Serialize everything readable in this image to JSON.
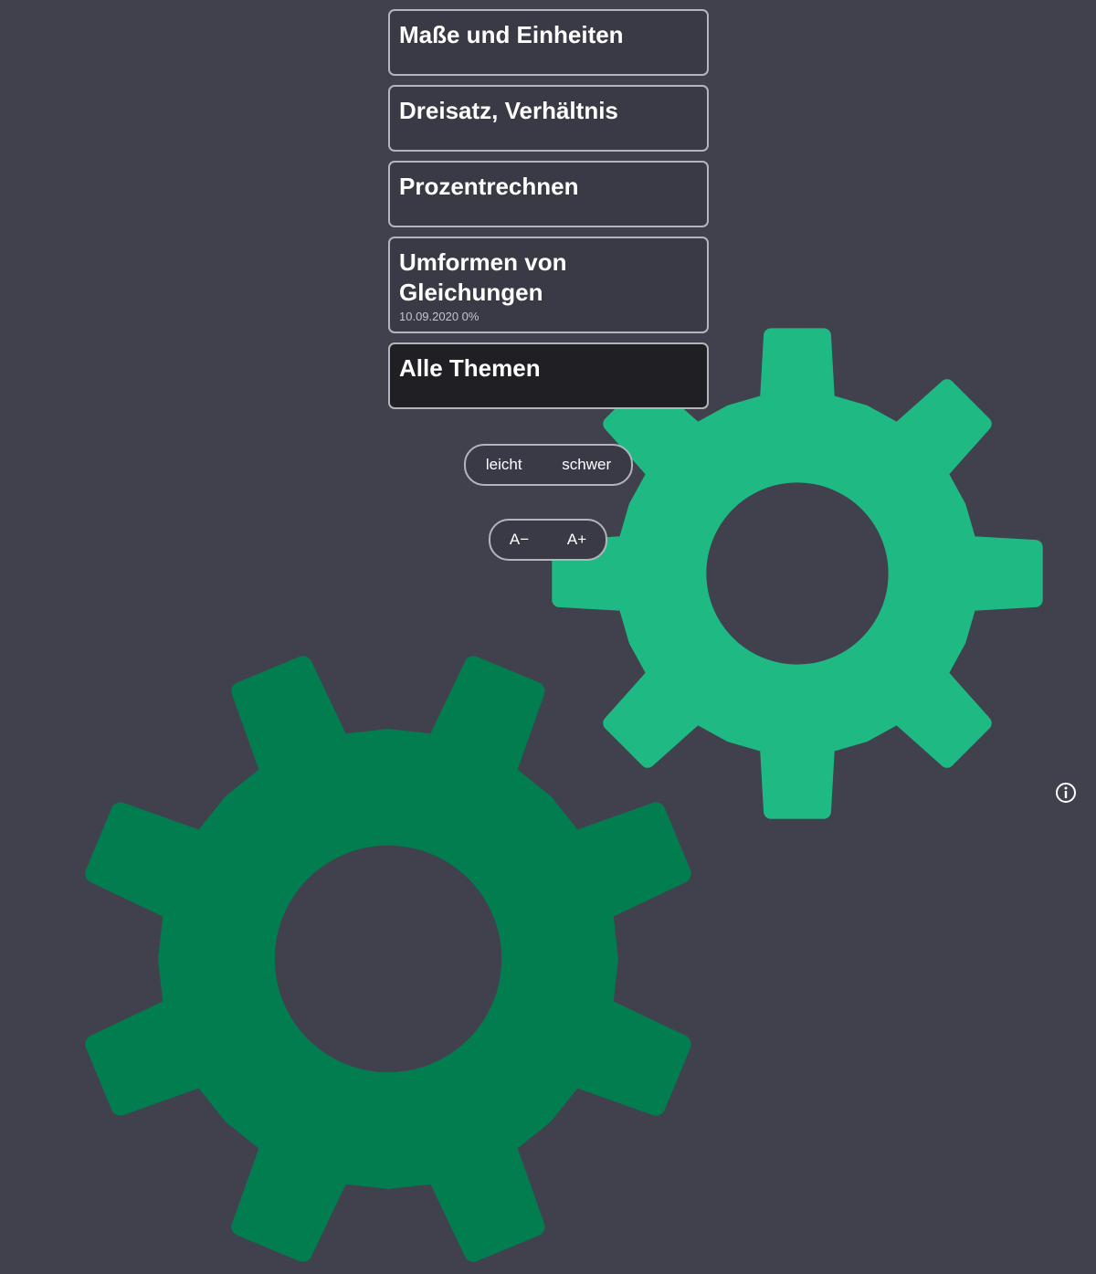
{
  "topics": [
    {
      "title": "Maße und Einheiten",
      "meta": ""
    },
    {
      "title": "Dreisatz, Verhältnis",
      "meta": ""
    },
    {
      "title": "Prozentrechnen",
      "meta": ""
    },
    {
      "title": "Umformen von Gleichungen",
      "meta": "10.09.2020 0%"
    },
    {
      "title": "Alle Themen",
      "meta": ""
    }
  ],
  "difficulty": {
    "easy_label": "leicht",
    "hard_label": "schwer"
  },
  "font_size": {
    "decrease_label": "A−",
    "increase_label": "A+"
  },
  "icons": {
    "info": "info-icon",
    "gear_large": "gear-icon",
    "gear_small": "gear-icon"
  },
  "colors": {
    "background": "#41414e",
    "gear_large": "#1fba84",
    "gear_small": "#017d4f",
    "active_topic": "#202024",
    "topic": "#3a3a46",
    "border": "#b4b4bc"
  }
}
